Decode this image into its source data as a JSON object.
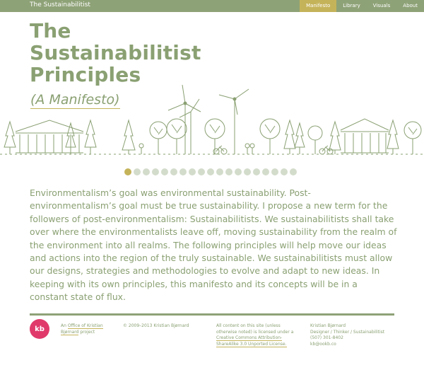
{
  "header": {
    "site_title": "The Sustainabilitist",
    "nav": [
      {
        "label": "Manifesto",
        "active": true
      },
      {
        "label": "Library",
        "active": false
      },
      {
        "label": "Visuals",
        "active": false
      },
      {
        "label": "About",
        "active": false
      }
    ]
  },
  "hero": {
    "title_lines": [
      "The",
      "Sustainabilitist",
      "Principles"
    ],
    "subtitle": "(A Manifesto)"
  },
  "carousel": {
    "total": 19,
    "active_index": 0
  },
  "body_text": "Environmentalism’s goal was environmental sustainability. Post-environmentalism’s goal must be true sustainability. I propose a new term for the followers of post-environmentalism: Sustainabilitists. We sustainabilitists shall take over where the environmentalists leave off, moving sustainability from the realm of the environment into all realms. The following principles will help move our ideas and actions into the region of the truly sustainable. We sustainabilitists must allow our designs, strategies and methodologies to evolve and adapt to new ideas. In keeping with its own principles, this manifesto and its concepts will be in a constant state of flux.",
  "footer": {
    "logo_text": "kb",
    "project_prefix": "An ",
    "project_link": "Office of Kristian Bjørnard",
    "project_suffix": " project",
    "copyright": "© 2009–2013 Kristian Bjørnard",
    "license_prefix": "All content on this site (unless otherwise noted) is licensed under a ",
    "license_link": "Creative Commons Attribution-ShareAlike 3.0 Unported License.",
    "contact": [
      "Kristian Bjørnard",
      "Designer / Thinker / Sustainabilitist",
      "(507) 301-8402",
      "kb@ookb.co"
    ]
  },
  "colors": {
    "primary": "#8ea277",
    "text": "#8aa072",
    "accent": "#c5b35a",
    "logo": "#e03a6b"
  }
}
